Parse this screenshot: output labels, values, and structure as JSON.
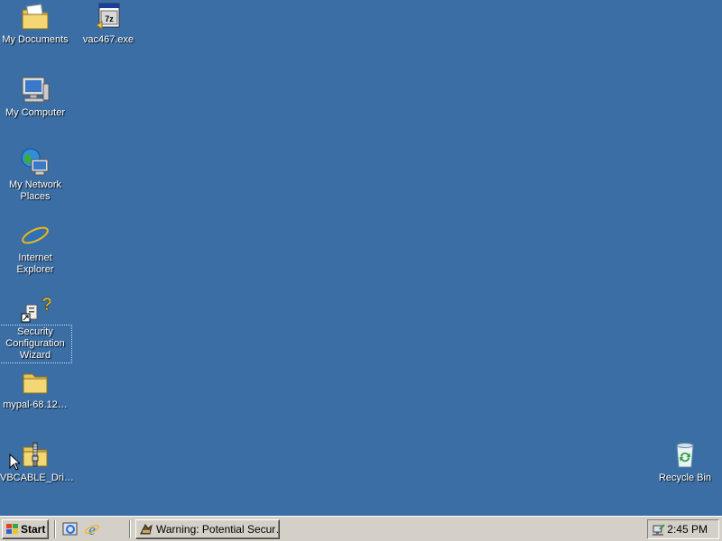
{
  "desktop": {
    "icons": [
      {
        "label": "My Documents",
        "icon": "my-documents-icon"
      },
      {
        "label": "vac467.exe",
        "icon": "7zip-installer-icon"
      },
      {
        "label": "My Computer",
        "icon": "my-computer-icon"
      },
      {
        "label": "My Network Places",
        "icon": "network-places-icon"
      },
      {
        "label": "Internet Explorer",
        "icon": "internet-explorer-icon"
      },
      {
        "label": "Security Configuration Wizard",
        "icon": "security-wizard-icon"
      },
      {
        "label": "mypal-68.12…",
        "icon": "folder-icon"
      },
      {
        "label": "VBCABLE_Dri…",
        "icon": "zip-folder-icon"
      },
      {
        "label": "Recycle Bin",
        "icon": "recycle-bin-icon"
      }
    ]
  },
  "taskbar": {
    "start_label": "Start",
    "task_button_label": "Warning: Potential Secur…",
    "clock": "2:45 PM"
  },
  "colors": {
    "desktop_bg": "#3A6EA5",
    "taskbar_bg": "#D4D0C8"
  }
}
